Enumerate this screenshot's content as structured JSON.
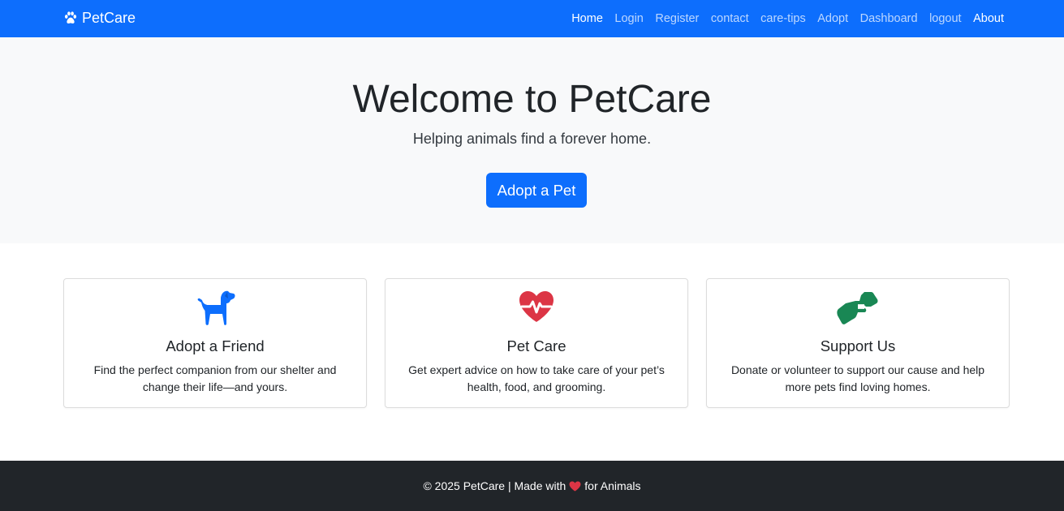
{
  "navbar": {
    "brand": "PetCare",
    "brand_icon": "paw-icon",
    "links": [
      {
        "label": "Home",
        "active": true
      },
      {
        "label": "Login",
        "active": false
      },
      {
        "label": "Register",
        "active": false
      },
      {
        "label": "contact",
        "active": false
      },
      {
        "label": "care-tips",
        "active": false
      },
      {
        "label": "Adopt",
        "active": false
      },
      {
        "label": "Dashboard",
        "active": false
      },
      {
        "label": "logout",
        "active": false
      },
      {
        "label": "About",
        "active": true
      }
    ]
  },
  "hero": {
    "title": "Welcome to PetCare",
    "subtitle": "Helping animals find a forever home.",
    "button_label": "Adopt a Pet"
  },
  "cards": [
    {
      "icon": "dog-icon",
      "icon_color": "#0d6efd",
      "title": "Adopt a Friend",
      "text": "Find the perfect companion from our shelter and change their life—and yours."
    },
    {
      "icon": "heart-pulse-icon",
      "icon_color": "#dc3545",
      "title": "Pet Care",
      "text": "Get expert advice on how to take care of your pet’s health, food, and grooming."
    },
    {
      "icon": "handshake-icon",
      "icon_color": "#198754",
      "title": "Support Us",
      "text": "Donate or volunteer to support our cause and help more pets find loving homes."
    }
  ],
  "footer": {
    "prefix": "© 2025 PetCare | Made with",
    "heart_icon": "heart-icon",
    "suffix": "for Animals"
  },
  "colors": {
    "primary": "#0d6efd",
    "danger": "#dc3545",
    "success": "#198754",
    "dark": "#212529",
    "light": "#f8f9fa"
  }
}
